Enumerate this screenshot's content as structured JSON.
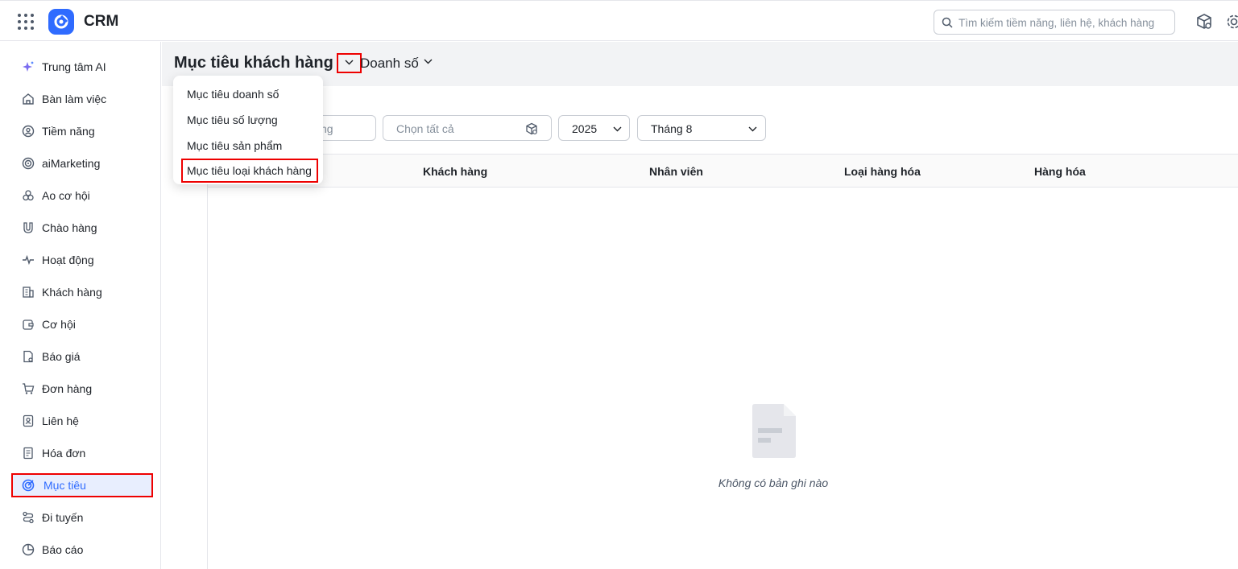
{
  "header": {
    "app_title": "CRM",
    "search_placeholder": "Tìm kiếm tiềm năng, liên hệ, khách hàng"
  },
  "sidebar": {
    "items": [
      {
        "label": "Trung tâm AI",
        "icon": "sparkle-icon"
      },
      {
        "label": "Bàn làm việc",
        "icon": "home-icon"
      },
      {
        "label": "Tiềm năng",
        "icon": "lead-icon"
      },
      {
        "label": "aiMarketing",
        "icon": "target-circle-icon"
      },
      {
        "label": "Ao cơ hội",
        "icon": "cluster-icon"
      },
      {
        "label": "Chào hàng",
        "icon": "magnet-icon"
      },
      {
        "label": "Hoạt động",
        "icon": "pulse-icon"
      },
      {
        "label": "Khách hàng",
        "icon": "building-icon"
      },
      {
        "label": "Cơ hội",
        "icon": "wallet-icon"
      },
      {
        "label": "Báo giá",
        "icon": "quote-doc-icon"
      },
      {
        "label": "Đơn hàng",
        "icon": "cart-icon"
      },
      {
        "label": "Liên hệ",
        "icon": "contact-card-icon"
      },
      {
        "label": "Hóa đơn",
        "icon": "invoice-icon"
      },
      {
        "label": "Mục tiêu",
        "icon": "goal-icon",
        "active": true
      },
      {
        "label": "Đi tuyến",
        "icon": "route-icon"
      },
      {
        "label": "Báo cáo",
        "icon": "pie-chart-icon"
      }
    ]
  },
  "main": {
    "title": "Mục tiêu khách hàng",
    "subtitle": "Doanh số",
    "filters": {
      "partial_placeholder": "ng",
      "select_all_placeholder": "Chọn tất cả",
      "year": "2025",
      "month": "Tháng 8"
    },
    "table": {
      "columns": [
        "Khách hàng",
        "Nhân viên",
        "Loại hàng hóa",
        "Hàng hóa"
      ]
    },
    "empty_text": "Không có bản ghi nào"
  },
  "dropdown": {
    "items": [
      {
        "label": "Mục tiêu doanh số"
      },
      {
        "label": "Mục tiêu số lượng"
      },
      {
        "label": "Mục tiêu sản phẩm"
      },
      {
        "label": "Mục tiêu loại khách hàng",
        "selected": true
      }
    ]
  },
  "colors": {
    "accent": "#2f6bff",
    "highlight_border": "#e00000",
    "active_bg": "#e8eefe"
  }
}
